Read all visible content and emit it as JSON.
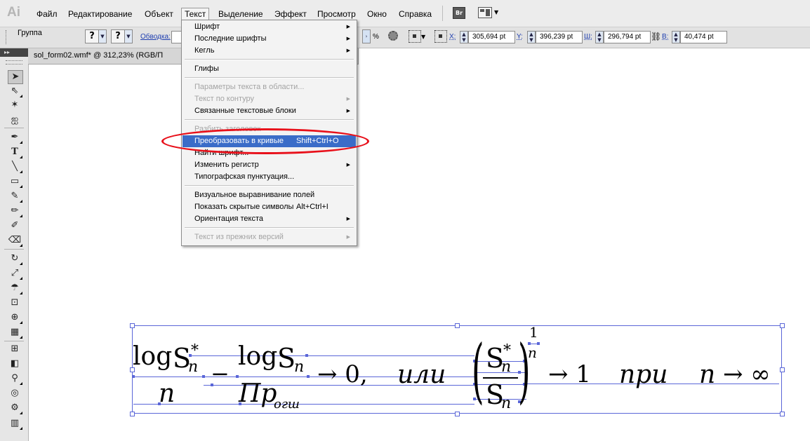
{
  "app": {
    "logo": "Ai"
  },
  "menubar": {
    "items": [
      "Файл",
      "Редактирование",
      "Объект",
      "Текст",
      "Выделение",
      "Эффект",
      "Просмотр",
      "Окно",
      "Справка"
    ],
    "bridge_label": "Br"
  },
  "controlbar": {
    "selection_label": "Группа",
    "q1": "?",
    "q2": "?",
    "stroke_label": "Обводка:",
    "percent_sign": "%",
    "x_label": "X:",
    "x_value": "305,694 pt",
    "y_label": "Y:",
    "y_value": "396,239 pt",
    "w_label": "Ш:",
    "w_value": "296,794 pt",
    "h_label": "В:",
    "h_value": "40,474 pt"
  },
  "document": {
    "tab_title": "sol_form02.wmf* @ 312,23% (RGB/П"
  },
  "text_menu": {
    "items": [
      {
        "label": "Шрифт",
        "submenu": true,
        "disabled": false
      },
      {
        "label": "Последние шрифты",
        "submenu": true,
        "disabled": false
      },
      {
        "label": "Кегль",
        "submenu": true,
        "disabled": false
      },
      {
        "label": "Глифы",
        "submenu": false,
        "disabled": false
      },
      {
        "label": "Параметры текста в области...",
        "submenu": false,
        "disabled": true
      },
      {
        "label": "Текст по контуру",
        "submenu": true,
        "disabled": true
      },
      {
        "label": "Связанные текстовые блоки",
        "submenu": true,
        "disabled": false
      },
      {
        "label": "Разбить заголовок",
        "submenu": false,
        "disabled": true
      },
      {
        "label": "Преобразовать в кривые",
        "shortcut": "Shift+Ctrl+O",
        "highlighted": true
      },
      {
        "label": "Найти шрифт...",
        "submenu": false,
        "disabled": false
      },
      {
        "label": "Изменить регистр",
        "submenu": true,
        "disabled": false
      },
      {
        "label": "Типографская пунктуация...",
        "submenu": false,
        "disabled": false
      },
      {
        "label": "Визуальное выравнивание полей",
        "submenu": false,
        "disabled": false
      },
      {
        "label": "Показать скрытые символы",
        "shortcut": "Alt+Ctrl+I",
        "disabled": false
      },
      {
        "label": "Ориентация текста",
        "submenu": true,
        "disabled": false
      },
      {
        "label": "Текст из прежних версий",
        "submenu": true,
        "disabled": true
      }
    ]
  },
  "annotation": {
    "color": "#e8101a"
  },
  "formula": {
    "log1": "log",
    "S1": "S",
    "star1": "*",
    "n1": "n",
    "minus": "−",
    "log2": "log",
    "S2": "S",
    "n2": "n",
    "den1": "n",
    "den2": "Пр",
    "den2_sub": "огш",
    "arrow0": "→ 0,",
    "or": "или",
    "S3": "S",
    "star3": "*",
    "n3": "n",
    "S4": "S",
    "n4": "n",
    "exp_num": "1",
    "exp_den": "n",
    "arrow1": "→ 1",
    "pri": "при",
    "n5": "n",
    "arrow_inf": "→ ∞"
  },
  "colors": {
    "accent": "#3a6cc8",
    "selection": "#5a66d8"
  }
}
